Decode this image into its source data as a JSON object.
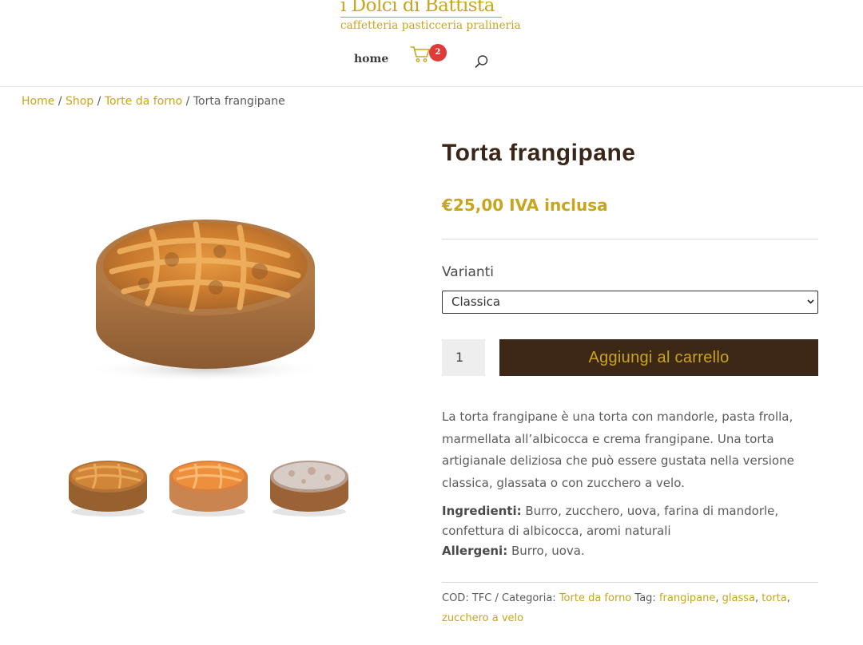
{
  "header": {
    "logo_main": "i Dolci di Battista",
    "logo_sub": "caffetteria pasticceria pralineria",
    "nav_home": "home",
    "cart_count": "2"
  },
  "breadcrumb": {
    "home": "Home",
    "shop": "Shop",
    "category": "Torte da forno",
    "current": "Torta frangipane",
    "separator": "/"
  },
  "product": {
    "title": "Torta frangipane",
    "price": "€25,00 IVA inclusa",
    "variants_label": "Varianti",
    "variant_selected": "Classica",
    "quantity": "1",
    "add_to_cart": "Aggiungi al carrello",
    "description": "La torta frangipane è una torta con mandorle, pasta frolla, marmellata all’albicocca e crema frangipane. Una torta artigianale deliziosa che può essere gustata nella versione classica, glassata o con zucchero a velo.",
    "ingredients_label": "Ingredienti:",
    "ingredients": "Burro, zucchero, uova, farina di mandorle, confettura di albicocca, aromi naturali",
    "allergens_label": "Allergeni:",
    "allergens": "Burro, uova."
  },
  "meta": {
    "cod_label": "COD:",
    "cod": "TFC",
    "slash": "/",
    "category_label": "Categoria:",
    "category": "Torte da forno",
    "tag_label": "Tag:",
    "tags": [
      "frangipane",
      "glassa",
      "torta",
      "zucchero a velo"
    ]
  },
  "colors": {
    "accent": "#c8a51c",
    "button_bg": "#3d2817",
    "title": "#3a2618",
    "badge": "#e03a3a"
  },
  "icons": {
    "cart": "cart-icon",
    "search": "search-icon",
    "select_chevron": "chevron-down-icon"
  }
}
